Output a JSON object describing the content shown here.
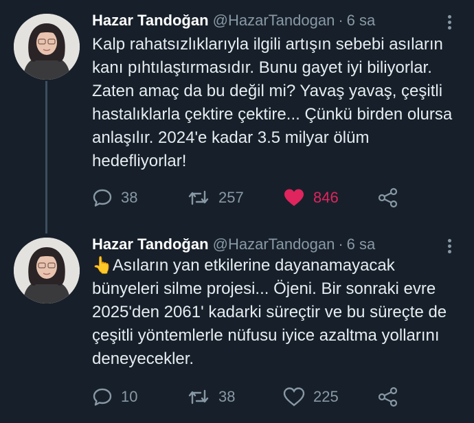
{
  "colors": {
    "background": "#17202a",
    "text": "#e6ecf0",
    "muted": "#8899a6",
    "like_active": "#e0245e"
  },
  "tweets": [
    {
      "name": "Hazar Tandoğan",
      "handle": "@HazarTandogan",
      "separator": "·",
      "time": "6 sa",
      "text": "Kalp rahatsızlıklarıyla ilgili artışın sebebi asıların kanı pıhtılaştırmasıdır. Bunu gayet iyi biliyorlar. Zaten amaç da bu değil mi? Yavaş yavaş, çeşitli hastalıklarla çektire çektire... Çünkü birden olursa anlaşılır. 2024'e kadar 3.5 milyar ölüm hedefliyorlar!",
      "replies": "38",
      "retweets": "257",
      "likes": "846",
      "liked": true
    },
    {
      "name": "Hazar Tandoğan",
      "handle": "@HazarTandogan",
      "separator": "·",
      "time": "6 sa",
      "text": "👆Asıların yan etkilerine dayanamayacak bünyeleri silme projesi... Öjeni. Bir sonraki evre 2025'den 2061' kadarki süreçtir ve bu süreçte de çeşitli yöntemlerle nüfusu iyice azaltma yollarını deneyecekler.",
      "replies": "10",
      "retweets": "38",
      "likes": "225",
      "liked": false
    }
  ],
  "icons": {
    "reply": "reply-icon",
    "retweet": "retweet-icon",
    "like": "heart-icon",
    "share": "share-icon",
    "more": "more-vertical-icon"
  }
}
